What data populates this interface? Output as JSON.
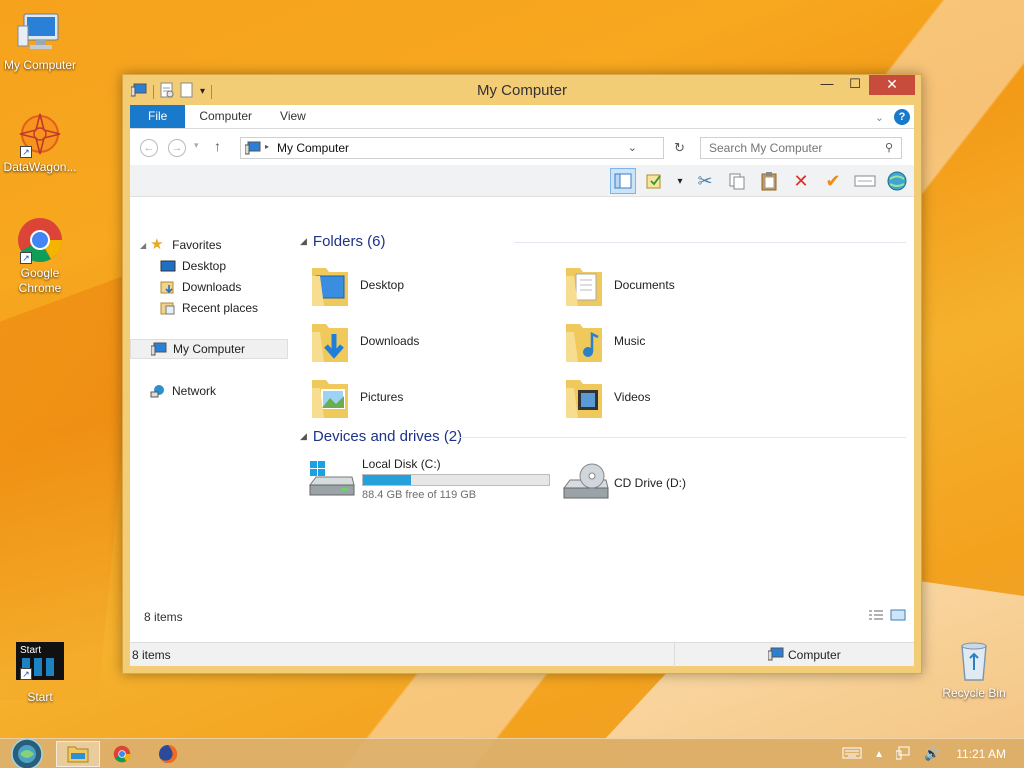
{
  "desktop": {
    "icons": [
      {
        "label": "My Computer"
      },
      {
        "label": "DataWagon..."
      },
      {
        "label": "Google Chrome"
      },
      {
        "label": "Start"
      },
      {
        "label": "Recycle Bin"
      }
    ],
    "start_tile_text": "Start"
  },
  "window": {
    "title": "My Computer",
    "controls": {
      "minimize": "—",
      "maximize": "☐",
      "close": "✕"
    },
    "ribbon_tabs": [
      {
        "label": "File"
      },
      {
        "label": "Computer"
      },
      {
        "label": "View"
      }
    ],
    "address": {
      "path": "My Computer"
    },
    "search": {
      "placeholder": "Search My Computer"
    },
    "nav_pane": {
      "favorites": "Favorites",
      "favorites_items": [
        {
          "label": "Desktop"
        },
        {
          "label": "Downloads"
        },
        {
          "label": "Recent places"
        }
      ],
      "my_computer": "My Computer",
      "network": "Network"
    },
    "groups": {
      "folders_header": "Folders (6)",
      "devices_header": "Devices and drives (2)"
    },
    "folders": [
      {
        "label": "Desktop"
      },
      {
        "label": "Documents"
      },
      {
        "label": "Downloads"
      },
      {
        "label": "Music"
      },
      {
        "label": "Pictures"
      },
      {
        "label": "Videos"
      }
    ],
    "drives": [
      {
        "label": "Local Disk (C:)",
        "free_text": "88.4 GB free of 119 GB",
        "used_fraction": 0.257
      },
      {
        "label": "CD Drive (D:)"
      }
    ],
    "item_count": "8 items",
    "statusbar": {
      "left": "8 items",
      "right": "Computer"
    }
  },
  "taskbar": {
    "clock": "11:21 AM"
  },
  "colors": {
    "accent": "#1979ca",
    "progress": "#26a0da",
    "window_frame": "#f3cc76",
    "close_button": "#c74c3c"
  }
}
